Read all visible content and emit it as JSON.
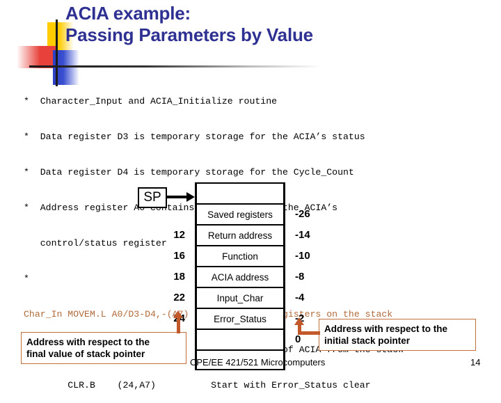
{
  "slide": {
    "title_line1": "ACIA example:",
    "title_line2": "Passing Parameters by Value",
    "title_color": "#2E3192"
  },
  "code": {
    "comment_lines": [
      "*  Character_Input and ACIA_Initialize routine",
      "*  Data register D3 is temporary storage for the ACIA’s status",
      "*  Data register D4 is temporary storage for the Cycle_Count",
      "*  Address register A0 contains the address of the ACIA’s",
      "   control/status register",
      "*"
    ],
    "instructions": [
      {
        "text": "Char_In MOVEM.L A0/D3-D4,-(A7)  Push working registers on the stack",
        "color": "#B06A3B",
        "highlight": true
      },
      {
        "text": "        MOVE.L   (18,A7),A0       Read address of ACIA from the stack",
        "color": "#000000",
        "highlight": false
      },
      {
        "text": "        CLR.B    (24,A7)          Start with Error_Status clear",
        "color": "#000000",
        "highlight": false
      }
    ]
  },
  "stack_diagram": {
    "pointer_label": "SP",
    "rows": [
      {
        "left": "",
        "label": "",
        "right": ""
      },
      {
        "left": "",
        "label": "Saved registers",
        "right": "-26"
      },
      {
        "left": "12",
        "label": "Return address",
        "right": "-14"
      },
      {
        "left": "16",
        "label": "Function",
        "right": "-10"
      },
      {
        "left": "18",
        "label": "ACIA address",
        "right": "-8"
      },
      {
        "left": "22",
        "label": "Input_Char",
        "right": "-4"
      },
      {
        "left": "24",
        "label": "Error_Status",
        "right": "-2"
      },
      {
        "left": "",
        "label": "",
        "right": "0"
      },
      {
        "left": "",
        "label": "",
        "right": ""
      }
    ]
  },
  "callouts": {
    "left": {
      "line1": "Address with respect to the",
      "line2": "final value of stack pointer",
      "border_color": "#C1703A"
    },
    "right": {
      "line1": "Address with respect to the",
      "line2": "initial stack pointer",
      "border_color": "#C1703A"
    },
    "connector_color": "#C1592A"
  },
  "footer": {
    "course": "CPE/EE 421/521 Microcomputers",
    "page": "14"
  }
}
